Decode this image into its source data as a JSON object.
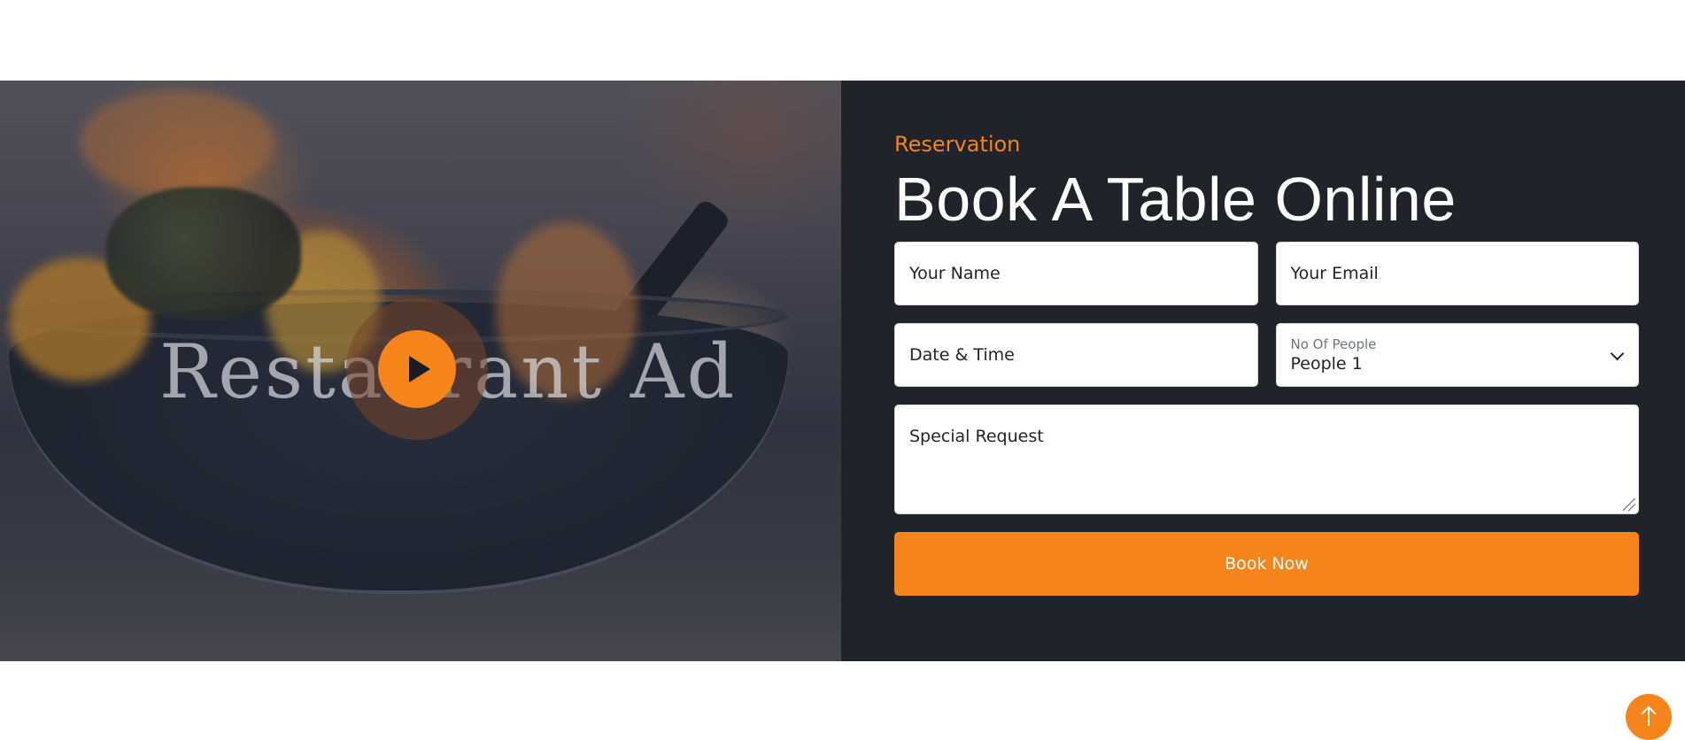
{
  "video": {
    "overlay_title": "Restaurant Ad",
    "play_icon": "play-icon"
  },
  "reservation": {
    "eyebrow": "Reservation",
    "heading": "Book A Table Online",
    "name_placeholder": "Your Name",
    "email_placeholder": "Your Email",
    "datetime_placeholder": "Date & Time",
    "people_caption": "No Of People",
    "people_value": "People 1",
    "request_placeholder": "Special Request",
    "submit_label": "Book Now"
  },
  "colors": {
    "accent": "#f5841a",
    "panel_bg": "#20232a"
  },
  "back_to_top_icon": "arrow-up-icon"
}
